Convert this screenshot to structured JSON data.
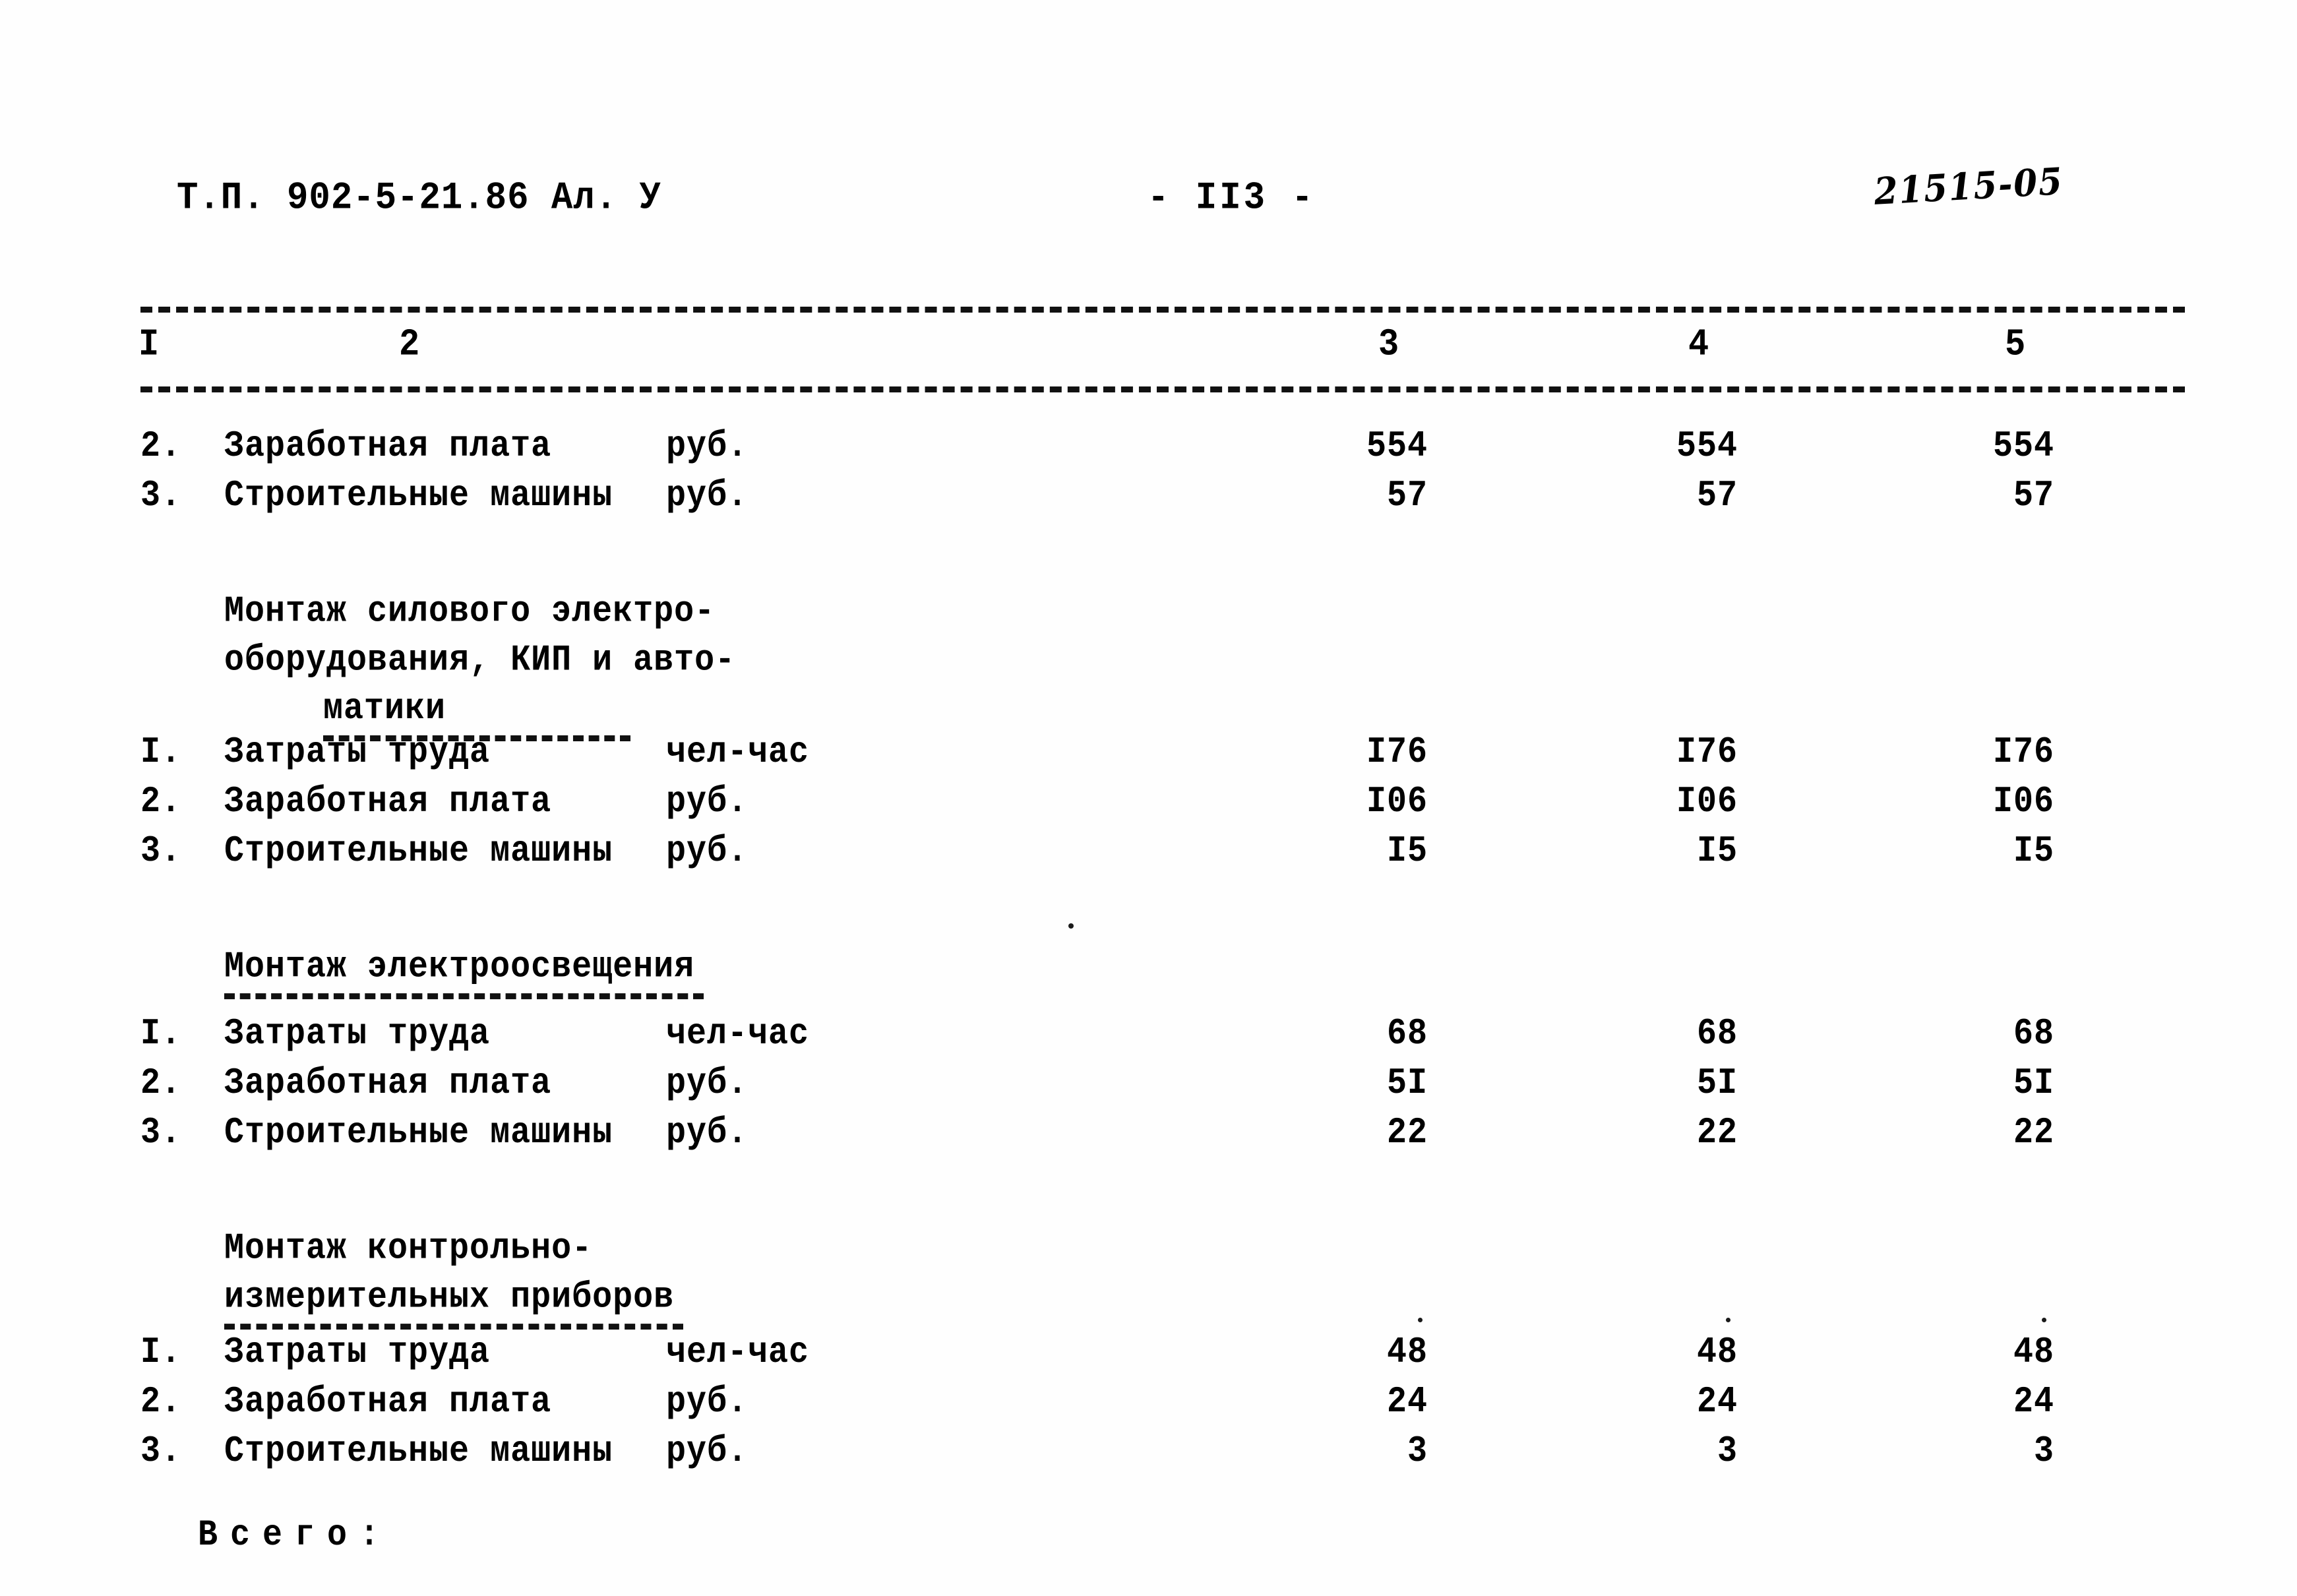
{
  "document": {
    "code": "Т.П. 902-5-21.86 Ал. У",
    "page_label": "- II3 -",
    "hand_annotation": "21515-05"
  },
  "table": {
    "column_headers": [
      "I",
      "2",
      "3",
      "4",
      "5"
    ],
    "sections": [
      {
        "heading_lines": [],
        "rows": [
          {
            "num": "2.",
            "label": "Заработная плата",
            "unit": "руб.",
            "v3": "554",
            "v4": "554",
            "v5": "554"
          },
          {
            "num": "3.",
            "label": "Строительные машины",
            "unit": "руб.",
            "v3": "57",
            "v4": "57",
            "v5": "57"
          }
        ]
      },
      {
        "heading_lines": [
          "Монтаж силового электро-",
          "оборудования, КИП и авто-",
          "матики"
        ],
        "heading_underline_line": 2,
        "heading_indent_last": true,
        "rows": [
          {
            "num": "I.",
            "label": "Затраты труда",
            "unit": "чел-час",
            "v3": "I76",
            "v4": "I76",
            "v5": "I76"
          },
          {
            "num": "2.",
            "label": "Заработная плата",
            "unit": "руб.",
            "v3": "I06",
            "v4": "I06",
            "v5": "I06"
          },
          {
            "num": "3.",
            "label": "Строительные машины",
            "unit": "руб.",
            "v3": "I5",
            "v4": "I5",
            "v5": "I5"
          }
        ]
      },
      {
        "heading_lines": [
          "Монтаж электроосвещения"
        ],
        "heading_underline_line": 0,
        "rows": [
          {
            "num": "I.",
            "label": "Затраты труда",
            "unit": "чел-час",
            "v3": "68",
            "v4": "68",
            "v5": "68"
          },
          {
            "num": "2.",
            "label": "Заработная плата",
            "unit": "руб.",
            "v3": "5I",
            "v4": "5I",
            "v5": "5I"
          },
          {
            "num": "3.",
            "label": "Строительные машины",
            "unit": "руб.",
            "v3": "22",
            "v4": "22",
            "v5": "22"
          }
        ]
      },
      {
        "heading_lines": [
          "Монтаж контрольно-",
          "измерительных приборов"
        ],
        "heading_underline_line": 1,
        "rows": [
          {
            "num": "I.",
            "label": "Затраты труда",
            "unit": "чел-час",
            "v3": "48",
            "v4": "48",
            "v5": "48"
          },
          {
            "num": "2.",
            "label": "Заработная плата",
            "unit": "руб.",
            "v3": "24",
            "v4": "24",
            "v5": "24"
          },
          {
            "num": "3.",
            "label": "Строительные машины",
            "unit": "руб.",
            "v3": "3",
            "v4": "3",
            "v5": "3"
          }
        ]
      }
    ],
    "totals_label": "Всего:"
  }
}
